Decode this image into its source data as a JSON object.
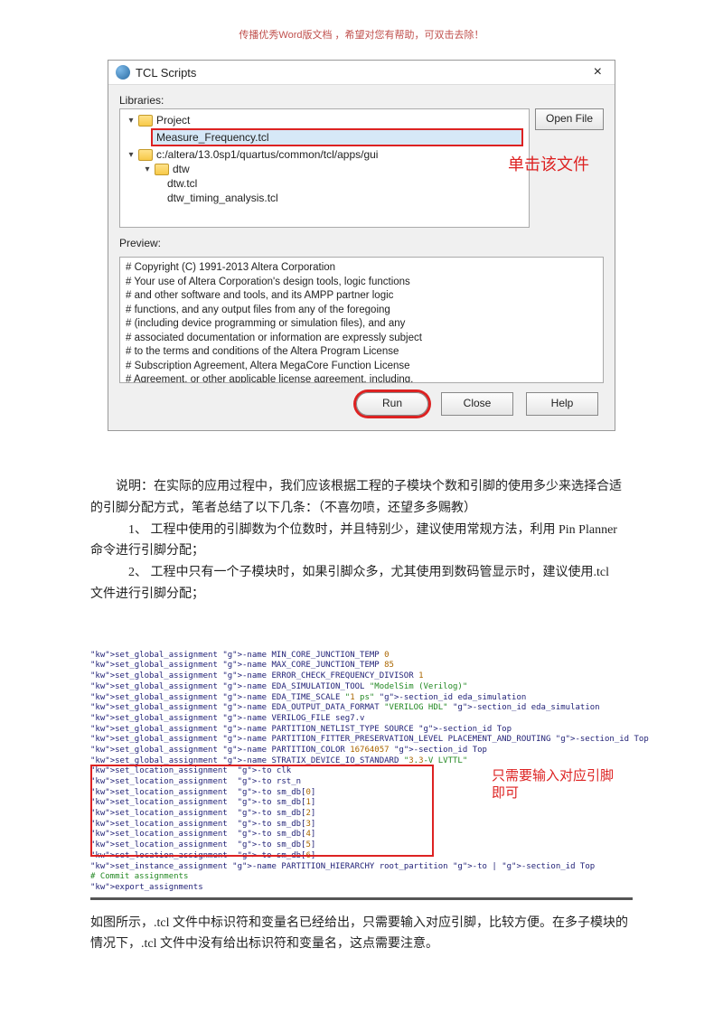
{
  "header": {
    "note": "传播优秀Word版文档 ，希望对您有帮助，可双击去除！"
  },
  "dialog": {
    "title": "TCL Scripts",
    "close": "×",
    "libraries_label": "Libraries:",
    "open_file": "Open File",
    "preview_label": "Preview:",
    "tree": {
      "project": "Project",
      "file_selected": "Measure_Frequency.tcl",
      "altera_path": "c:/altera/13.0sp1/quartus/common/tcl/apps/gui",
      "dtw": "dtw",
      "dtw_tcl": "dtw.tcl",
      "dtw_timing": "dtw_timing_analysis.tcl"
    },
    "callout_click": "单击该文件",
    "preview_lines": [
      "# Copyright (C) 1991-2013 Altera Corporation",
      "# Your use of Altera Corporation's design tools, logic functions",
      "# and other software and tools, and its AMPP partner logic",
      "# functions, and any output files from any of the foregoing",
      "# (including device programming or simulation files), and any",
      "# associated documentation or information are expressly subject",
      "# to the terms and conditions of the Altera Program License",
      "# Subscription Agreement, Altera MegaCore Function License",
      "# Agreement, or other applicable license agreement, including,"
    ],
    "buttons": {
      "run": "Run",
      "close": "Close",
      "help": "Help"
    }
  },
  "text": {
    "p1": "说明：在实际的应用过程中，我们应该根据工程的子模块个数和引脚的使用多少来选择合适的引脚分配方式，笔者总结了以下几条：（不喜勿喷，还望多多赐教）",
    "li1": "1、 工程中使用的引脚数为个位数时，并且特别少，建议使用常规方法，利用 Pin Planner",
    "p2": "命令进行引脚分配；",
    "li2": "2、 工程中只有一个子模块时，如果引脚众多，尤其使用到数码管显示时，建议使用.tcl",
    "p3": "文件进行引脚分配；",
    "callout2a": "只需要输入对应引脚",
    "callout2b": "即可",
    "p4": "如图所示，.tcl 文件中标识符和变量名已经给出，只需要输入对应引脚，比较方便。在多子模块的情况下，.tcl 文件中没有给出标识符和变量名，这点需要注意。"
  },
  "code": {
    "lines": [
      "set_global_assignment -name MIN_CORE_JUNCTION_TEMP 0",
      "set_global_assignment -name MAX_CORE_JUNCTION_TEMP 85",
      "set_global_assignment -name ERROR_CHECK_FREQUENCY_DIVISOR 1",
      "set_global_assignment -name EDA_SIMULATION_TOOL \"ModelSim (Verilog)\"",
      "set_global_assignment -name EDA_TIME_SCALE \"1 ps\" -section_id eda_simulation",
      "set_global_assignment -name EDA_OUTPUT_DATA_FORMAT \"VERILOG HDL\" -section_id eda_simulation",
      "set_global_assignment -name VERILOG_FILE seg7.v",
      "set_global_assignment -name PARTITION_NETLIST_TYPE SOURCE -section_id Top",
      "set_global_assignment -name PARTITION_FITTER_PRESERVATION_LEVEL PLACEMENT_AND_ROUTING -section_id Top",
      "set_global_assignment -name PARTITION_COLOR 16764057 -section_id Top",
      "set_global_assignment -name STRATIX_DEVICE_IO_STANDARD \"3.3-V LVTTL\"",
      "set_location_assignment  -to clk",
      "set_location_assignment  -to rst_n",
      "set_location_assignment  -to sm_db[0]",
      "set_location_assignment  -to sm_db[1]",
      "set_location_assignment  -to sm_db[2]",
      "set_location_assignment  -to sm_db[3]",
      "set_location_assignment  -to sm_db[4]",
      "set_location_assignment  -to sm_db[5]",
      "set_location_assignment  -to sm_db[6]",
      "set_instance_assignment -name PARTITION_HIERARCHY root_partition -to | -section_id Top",
      "",
      "# Commit assignments",
      "export_assignments"
    ]
  }
}
